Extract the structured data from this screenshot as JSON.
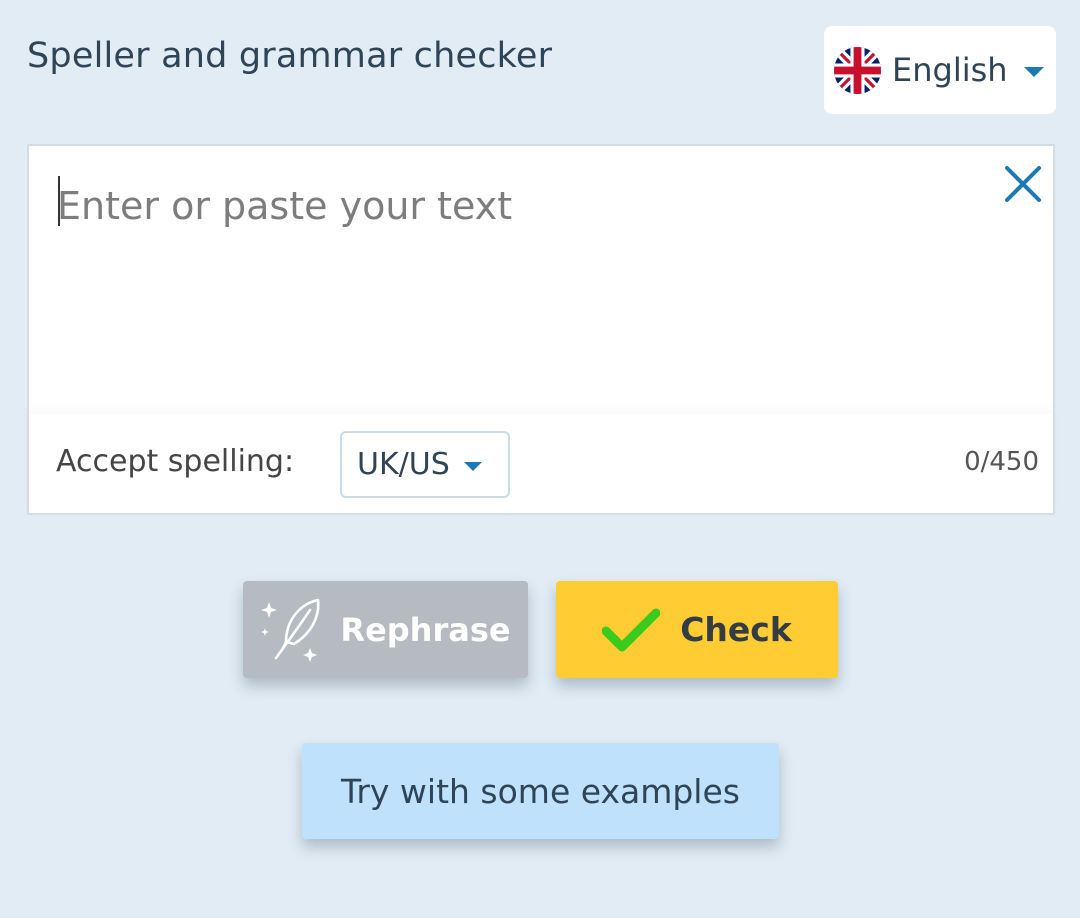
{
  "header": {
    "title": "Speller and grammar checker"
  },
  "language_select": {
    "value": "English",
    "flag_icon": "uk-flag-icon",
    "caret_icon": "caret-down-icon"
  },
  "editor": {
    "placeholder": "Enter or paste your text",
    "value": "",
    "clear_icon": "close-icon",
    "accept_spelling_label": "Accept spelling:",
    "spelling_value": "UK/US",
    "counter": "0/450"
  },
  "actions": {
    "rephrase_label": "Rephrase",
    "rephrase_icon": "feather-sparkle-icon",
    "check_label": "Check",
    "check_icon": "checkmark-icon",
    "examples_label": "Try with some examples"
  },
  "colors": {
    "background": "#e1ecf5",
    "accent": "#1c79b1",
    "check_button": "#ffcc33",
    "rephrase_button": "#b6bbc1",
    "examples_button": "#bfe1fb",
    "checkmark": "#3bcb1c"
  }
}
